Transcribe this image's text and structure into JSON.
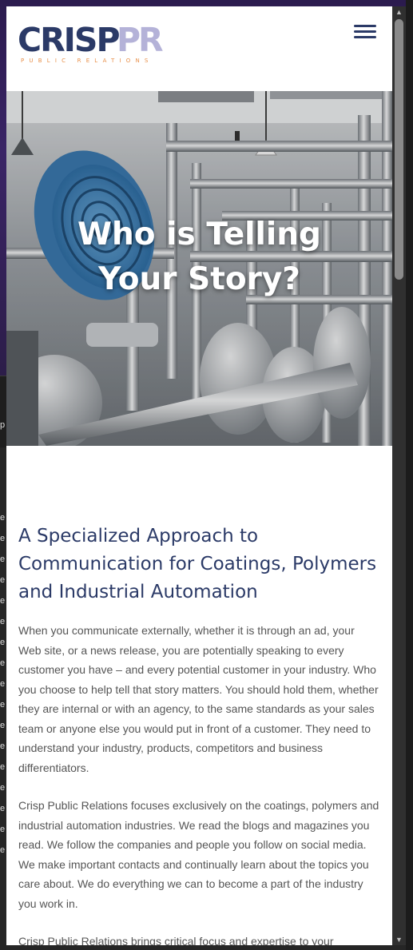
{
  "brand": {
    "wordmark_main": "CRISP",
    "wordmark_accent": "PR",
    "tagline": "PUBLIC RELATIONS",
    "colors": {
      "navy": "#2b3a67",
      "lavender": "#b4b2d8",
      "orange": "#e8904a"
    }
  },
  "header": {
    "menu_icon": "hamburger-icon"
  },
  "hero": {
    "title": "Who is Telling Your Story?"
  },
  "main": {
    "heading": "A Specialized Approach to Communication for Coatings, Polymers and Industrial Automation",
    "paragraphs": [
      "When you communicate externally, whether it is through an ad, your Web site, or a news release, you are potentially speaking to every customer you have – and every potential customer in your industry. Who you choose to help tell that story matters. You should hold them, whether they are internal or with an agency, to the same standards as your sales team or anyone else you would put in front of a customer. They need to understand your industry, products, competitors and business differentiators.",
      "Crisp Public Relations focuses exclusively on the coatings, polymers and industrial automation industries. We read the blogs and magazines you read. We follow the companies and people you follow on social media. We make important contacts and continually learn about the topics you care about. We do everything we can to become a part of the industry you work in.",
      "Crisp Public Relations brings critical focus and expertise to your marketing communication – whether you are a manufacturer or a marketing"
    ]
  },
  "scrollbar": {
    "up_icon": "▲",
    "down_icon": "▼"
  }
}
